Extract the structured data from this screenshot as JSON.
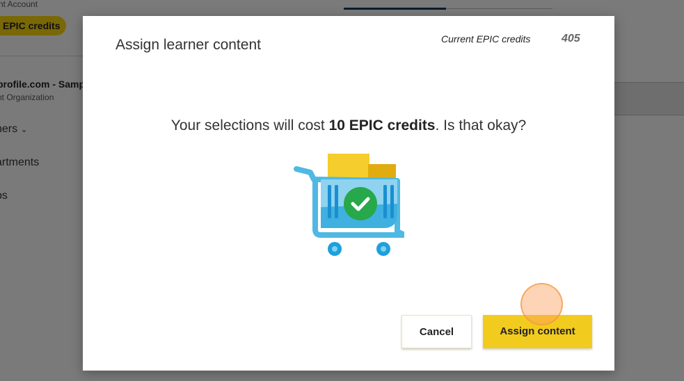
{
  "background": {
    "account_label": "nt Account",
    "credits_pill": "EPIC credits",
    "org_name": "profile.com - Samp",
    "org_type": "nt Organization",
    "nav": [
      "ners",
      "artments",
      "ps"
    ]
  },
  "modal": {
    "title": "Assign learner content",
    "current_credits_label": "Current EPIC credits",
    "current_credits_value": "405",
    "message_prefix": "Your selections will cost ",
    "message_cost": "10 EPIC credits",
    "message_suffix": ". Is that okay?",
    "illustration": "shopping-cart-check-icon",
    "cancel_label": "Cancel",
    "assign_label": "Assign content"
  },
  "colors": {
    "accent": "#f2cb1f",
    "overlay": "rgba(0,0,0,0.5)"
  }
}
